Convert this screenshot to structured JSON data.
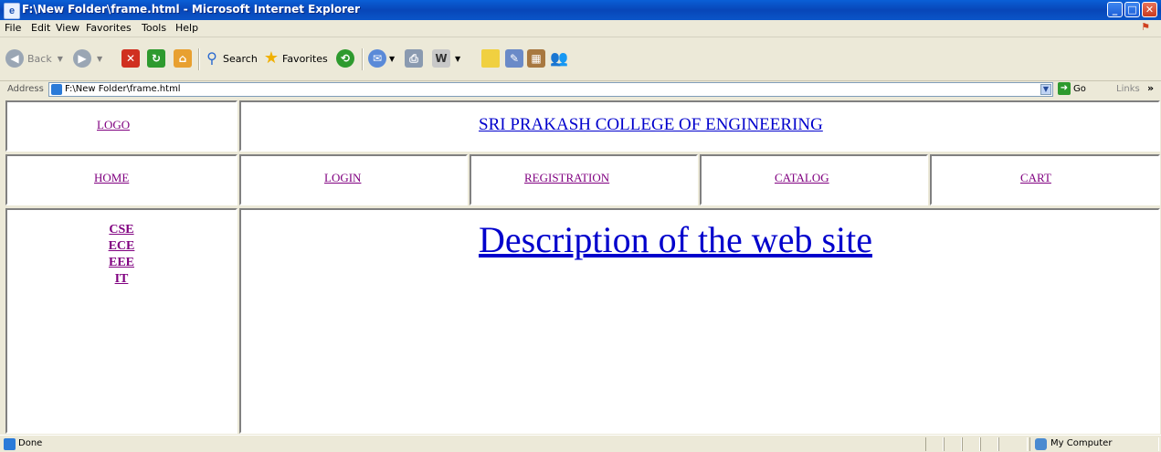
{
  "window": {
    "title": "F:\\New Folder\\frame.html - Microsoft Internet Explorer",
    "controls": {
      "minimize": "_",
      "maximize": "□",
      "close": "✕"
    }
  },
  "menu": [
    "File",
    "Edit",
    "View",
    "Favorites",
    "Tools",
    "Help"
  ],
  "toolbar": {
    "back": "Back",
    "search": "Search",
    "favorites": "Favorites"
  },
  "address": {
    "label": "Address",
    "url": "F:\\New Folder\\frame.html",
    "go": "Go",
    "links": "Links",
    "more": "»"
  },
  "page": {
    "logo": "LOGO",
    "college": "SRI PRAKASH COLLEGE OF ENGINEERING",
    "nav": [
      "HOME",
      "LOGIN",
      "REGISTRATION",
      "CATALOG",
      "CART"
    ],
    "departments": [
      "CSE",
      "ECE",
      "EEE",
      "IT"
    ],
    "description": "Description of the web site"
  },
  "status": {
    "text": "Done",
    "zone": "My Computer"
  }
}
